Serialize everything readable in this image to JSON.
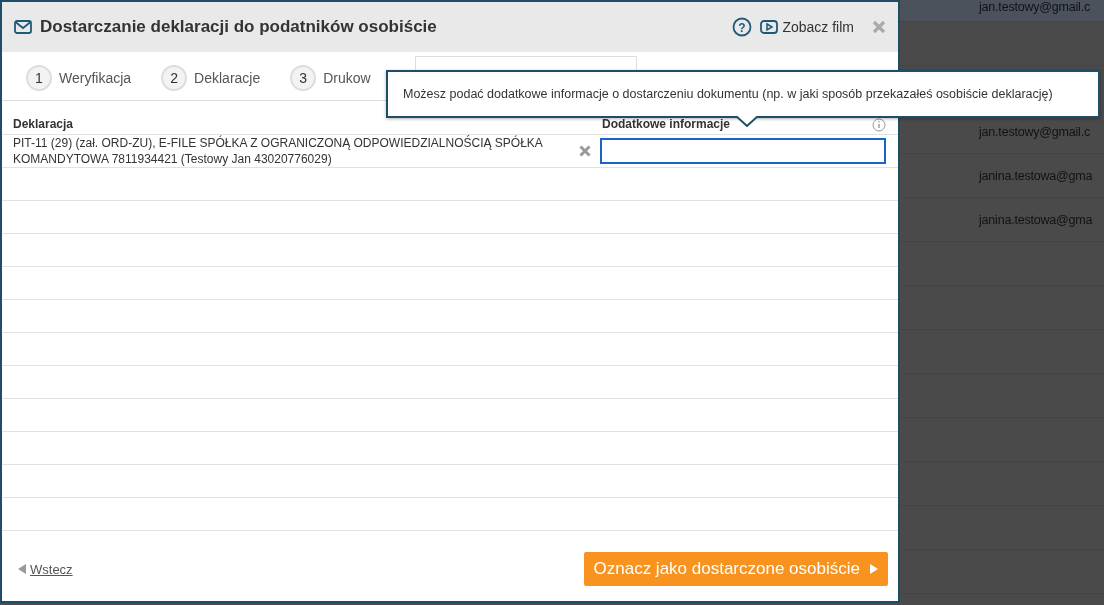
{
  "background_list": {
    "rows": [
      "jan.testowy@gmail.c",
      "",
      "",
      "jan.testowy@gmail.c",
      "janina.testowa@gma",
      "janina.testowa@gma",
      "",
      "",
      "",
      "",
      "",
      "",
      "",
      ""
    ]
  },
  "dialog": {
    "title": "Dostarczanie deklaracji do podatników osobiście",
    "help": "?",
    "video_link": "Zobacz film"
  },
  "steps": [
    {
      "number": "1",
      "label": "Weryfikacja",
      "selected": false
    },
    {
      "number": "2",
      "label": "Deklaracje",
      "selected": false
    },
    {
      "number": "3",
      "label": "Drukow",
      "selected": false
    },
    {
      "selected": true
    }
  ],
  "tooltip": "Możesz podać dodatkowe informacje o dostarczeniu dokumentu (np. w jaki sposób przekazałeś osobiście deklarację)",
  "table": {
    "columns": [
      "Deklaracja",
      "Dodatkowe informacje"
    ],
    "rows": [
      {
        "declaration": "PIT-11 (29) (zał. ORD-ZU), E-FILE SPÓŁKA Z OGRANICZONĄ ODPOWIEDZIALNOŚCIĄ SPÓŁKA KOMANDYTOWA 7811934421 (Testowy Jan 43020776029)"
      }
    ]
  },
  "footer": {
    "back": "Wstecz",
    "confirm": "Oznacz jako dostarczone osobiście"
  }
}
